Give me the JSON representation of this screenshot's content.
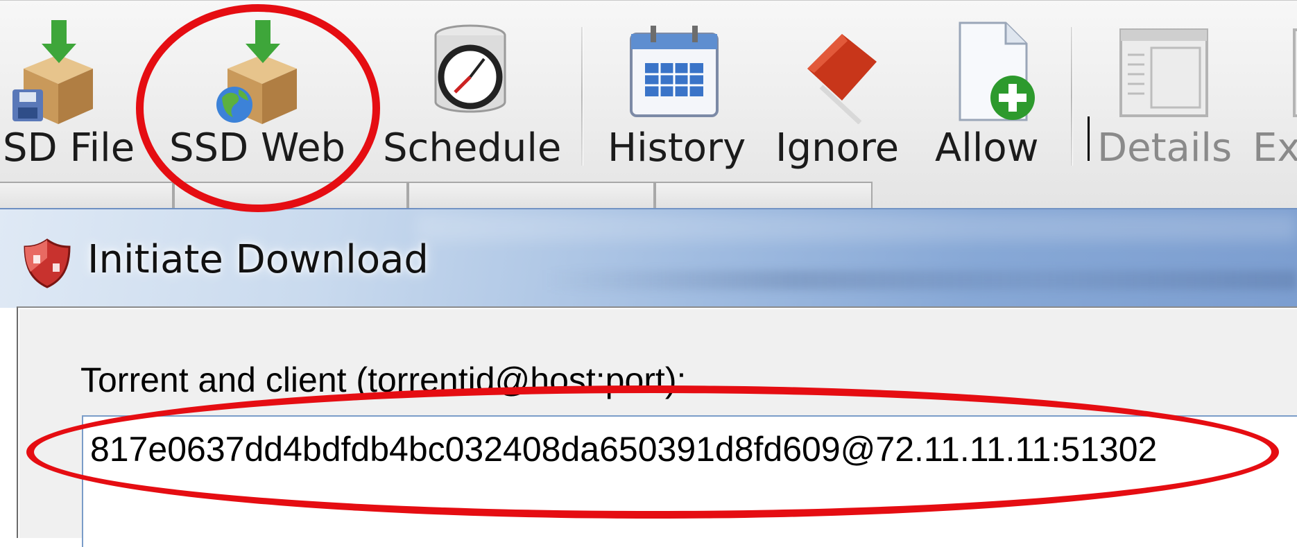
{
  "toolbar": {
    "buttons": [
      {
        "id": "ssd-file",
        "label": "SD File",
        "icon": "box-download-disk-icon",
        "enabled": true
      },
      {
        "id": "ssd-web",
        "label": "SSD Web",
        "icon": "box-download-globe-icon",
        "enabled": true
      },
      {
        "id": "schedule",
        "label": "Schedule",
        "icon": "clock-icon",
        "enabled": true
      },
      {
        "id": "history",
        "label": "History",
        "icon": "calendar-icon",
        "enabled": true
      },
      {
        "id": "ignore",
        "label": "Ignore",
        "icon": "red-flag-icon",
        "enabled": true
      },
      {
        "id": "allow",
        "label": "Allow",
        "icon": "document-add-icon",
        "enabled": true
      },
      {
        "id": "details",
        "label": "Details",
        "icon": "details-window-icon",
        "enabled": false
      },
      {
        "id": "ex",
        "label": "Ex",
        "icon": "window-icon",
        "enabled": false
      }
    ]
  },
  "dialog": {
    "title": "Initiate Download",
    "icon": "shield-icon",
    "field_label": "Torrent and client (torrentid@host:port):",
    "field_value": "817e0637dd4bdfdb4bc032408da650391d8fd609@72.11.11.11:51302"
  },
  "colors": {
    "highlight": "#e50d12",
    "titlebar": "#9fbbe0",
    "input_border": "#7a9cc8"
  }
}
